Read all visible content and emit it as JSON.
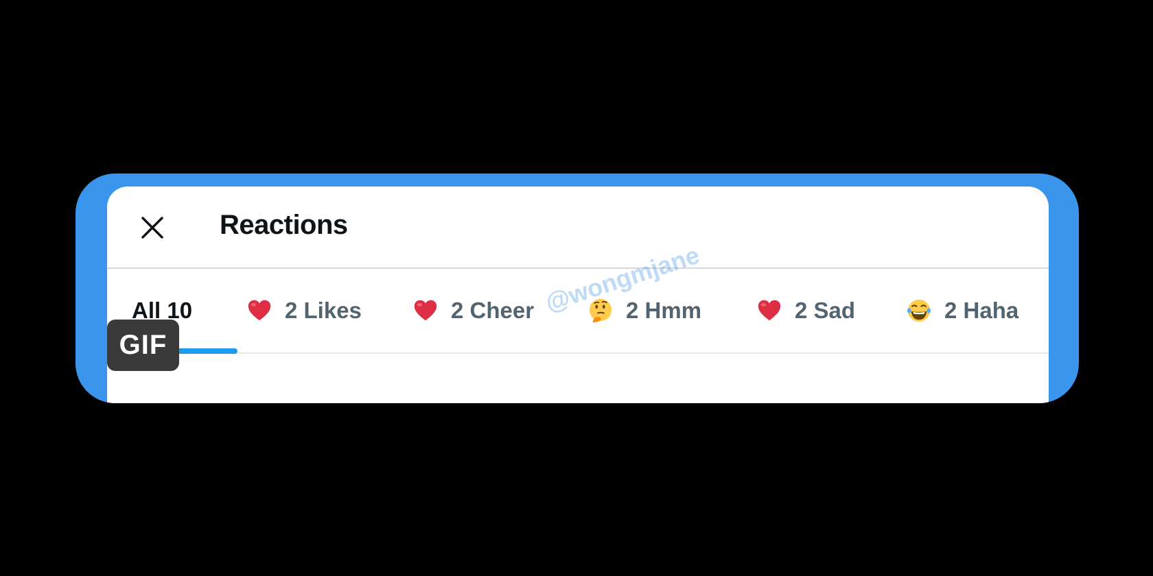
{
  "header": {
    "close_icon": "close-icon",
    "title": "Reactions"
  },
  "tabs": [
    {
      "label": "All 10",
      "emoji": null,
      "active": true
    },
    {
      "label": "2 Likes",
      "emoji": "heart-icon",
      "active": false
    },
    {
      "label": "2 Cheer",
      "emoji": "heart-icon",
      "active": false
    },
    {
      "label": "2 Hmm",
      "emoji": "thinking-face-icon",
      "active": false
    },
    {
      "label": "2 Sad",
      "emoji": "heart-icon",
      "active": false
    },
    {
      "label": "2 Haha",
      "emoji": "laughing-face-icon",
      "active": false
    }
  ],
  "watermark": "@wongmjane",
  "gif_badge": "GIF",
  "colors": {
    "frame": "#3a95ec",
    "accent": "#1d9bf0",
    "title": "#0f1419",
    "tab_inactive": "#536471",
    "heart": "#e0245e"
  }
}
